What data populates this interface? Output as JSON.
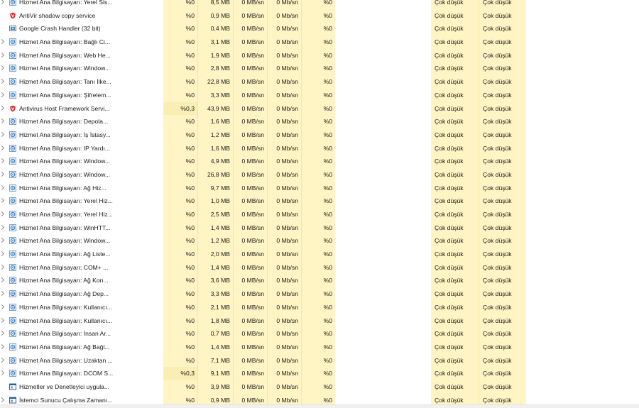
{
  "processes": [
    {
      "name": "Hizmet Ana Bilgisayarı: Yerel Sis...",
      "icon": "gear",
      "expand": true,
      "cpu": "%0",
      "mem": "8,5 MB",
      "disk": "0 MB/sn",
      "net": "0 Mb/sn",
      "gpu": "%0",
      "pwr": "Çok düşük",
      "pwt": "Çok düşük"
    },
    {
      "name": "AntiVir shadow copy service",
      "icon": "shield",
      "expand": false,
      "cpu": "%0",
      "mem": "0,9 MB",
      "disk": "0 MB/sn",
      "net": "0 Mb/sn",
      "gpu": "%0",
      "pwr": "Çok düşük",
      "pwt": "Çok düşük"
    },
    {
      "name": "Google Crash Handler (32 bit)",
      "icon": "app",
      "expand": false,
      "cpu": "%0",
      "mem": "0,4 MB",
      "disk": "0 MB/sn",
      "net": "0 Mb/sn",
      "gpu": "%0",
      "pwr": "Çok düşük",
      "pwt": "Çok düşük"
    },
    {
      "name": "Hizmet Ana Bilgisayarı: Bağlı Ci...",
      "icon": "gear",
      "expand": true,
      "cpu": "%0",
      "mem": "3,1 MB",
      "disk": "0 MB/sn",
      "net": "0 Mb/sn",
      "gpu": "%0",
      "pwr": "Çok düşük",
      "pwt": "Çok düşük"
    },
    {
      "name": "Hizmet Ana Bilgisayarı: Web He...",
      "icon": "gear",
      "expand": true,
      "cpu": "%0",
      "mem": "1,9 MB",
      "disk": "0 MB/sn",
      "net": "0 Mb/sn",
      "gpu": "%0",
      "pwr": "Çok düşük",
      "pwt": "Çok düşük"
    },
    {
      "name": "Hizmet Ana Bilgisayarı: Window...",
      "icon": "gear",
      "expand": true,
      "cpu": "%0",
      "mem": "2,8 MB",
      "disk": "0 MB/sn",
      "net": "0 Mb/sn",
      "gpu": "%0",
      "pwr": "Çok düşük",
      "pwt": "Çok düşük"
    },
    {
      "name": "Hizmet Ana Bilgisayarı: Tanı İlke...",
      "icon": "gear",
      "expand": true,
      "cpu": "%0",
      "mem": "22,8 MB",
      "disk": "0 MB/sn",
      "net": "0 Mb/sn",
      "gpu": "%0",
      "pwr": "Çok düşük",
      "pwt": "Çok düşük"
    },
    {
      "name": "Hizmet Ana Bilgisayarı: Şifrelem...",
      "icon": "gear",
      "expand": true,
      "cpu": "%0",
      "mem": "3,3 MB",
      "disk": "0 MB/sn",
      "net": "0 Mb/sn",
      "gpu": "%0",
      "pwr": "Çok düşük",
      "pwt": "Çok düşük"
    },
    {
      "name": "Antivirus Host Framework Servi...",
      "icon": "shield",
      "expand": true,
      "cpu": "%0,3",
      "mem": "43,9 MB",
      "disk": "0 MB/sn",
      "net": "0 Mb/sn",
      "gpu": "%0",
      "pwr": "Çok düşük",
      "pwt": "Çok düşük",
      "hl": true
    },
    {
      "name": "Hizmet Ana Bilgisayarı: Depola...",
      "icon": "gear",
      "expand": true,
      "cpu": "%0",
      "mem": "1,6 MB",
      "disk": "0 MB/sn",
      "net": "0 Mb/sn",
      "gpu": "%0",
      "pwr": "Çok düşük",
      "pwt": "Çok düşük"
    },
    {
      "name": "Hizmet Ana Bilgisayarı: İş İstasy...",
      "icon": "gear",
      "expand": true,
      "cpu": "%0",
      "mem": "1,2 MB",
      "disk": "0 MB/sn",
      "net": "0 Mb/sn",
      "gpu": "%0",
      "pwr": "Çok düşük",
      "pwt": "Çok düşük"
    },
    {
      "name": "Hizmet Ana Bilgisayarı: IP Yardı...",
      "icon": "gear",
      "expand": true,
      "cpu": "%0",
      "mem": "1,6 MB",
      "disk": "0 MB/sn",
      "net": "0 Mb/sn",
      "gpu": "%0",
      "pwr": "Çok düşük",
      "pwt": "Çok düşük"
    },
    {
      "name": "Hizmet Ana Bilgisayarı: Window...",
      "icon": "gear",
      "expand": true,
      "cpu": "%0",
      "mem": "4,9 MB",
      "disk": "0 MB/sn",
      "net": "0 Mb/sn",
      "gpu": "%0",
      "pwr": "Çok düşük",
      "pwt": "Çok düşük"
    },
    {
      "name": "Hizmet Ana Bilgisayarı: Window...",
      "icon": "gear",
      "expand": true,
      "cpu": "%0",
      "mem": "26,8 MB",
      "disk": "0 MB/sn",
      "net": "0 Mb/sn",
      "gpu": "%0",
      "pwr": "Çok düşük",
      "pwt": "Çok düşük"
    },
    {
      "name": "Hizmet Ana Bilgisayarı: Ağ Hiz...",
      "icon": "gear",
      "expand": true,
      "cpu": "%0",
      "mem": "9,7 MB",
      "disk": "0 MB/sn",
      "net": "0 Mb/sn",
      "gpu": "%0",
      "pwr": "Çok düşük",
      "pwt": "Çok düşük"
    },
    {
      "name": "Hizmet Ana Bilgisayarı: Yerel Hiz...",
      "icon": "gear",
      "expand": true,
      "cpu": "%0",
      "mem": "1,0 MB",
      "disk": "0 MB/sn",
      "net": "0 Mb/sn",
      "gpu": "%0",
      "pwr": "Çok düşük",
      "pwt": "Çok düşük"
    },
    {
      "name": "Hizmet Ana Bilgisayarı: Yerel Hiz...",
      "icon": "gear",
      "expand": true,
      "cpu": "%0",
      "mem": "2,5 MB",
      "disk": "0 MB/sn",
      "net": "0 Mb/sn",
      "gpu": "%0",
      "pwr": "Çok düşük",
      "pwt": "Çok düşük"
    },
    {
      "name": "Hizmet Ana Bilgisayarı: WinHTT...",
      "icon": "gear",
      "expand": true,
      "cpu": "%0",
      "mem": "1,4 MB",
      "disk": "0 MB/sn",
      "net": "0 Mb/sn",
      "gpu": "%0",
      "pwr": "Çok düşük",
      "pwt": "Çok düşük"
    },
    {
      "name": "Hizmet Ana Bilgisayarı: Window...",
      "icon": "gear",
      "expand": true,
      "cpu": "%0",
      "mem": "1,2 MB",
      "disk": "0 MB/sn",
      "net": "0 Mb/sn",
      "gpu": "%0",
      "pwr": "Çok düşük",
      "pwt": "Çok düşük"
    },
    {
      "name": "Hizmet Ana Bilgisayarı: Ağ Liste...",
      "icon": "gear",
      "expand": true,
      "cpu": "%0",
      "mem": "2,0 MB",
      "disk": "0 MB/sn",
      "net": "0 Mb/sn",
      "gpu": "%0",
      "pwr": "Çok düşük",
      "pwt": "Çok düşük"
    },
    {
      "name": "Hizmet Ana Bilgisayarı: COM+ ...",
      "icon": "gear",
      "expand": true,
      "cpu": "%0",
      "mem": "1,4 MB",
      "disk": "0 MB/sn",
      "net": "0 Mb/sn",
      "gpu": "%0",
      "pwr": "Çok düşük",
      "pwt": "Çok düşük"
    },
    {
      "name": "Hizmet Ana Bilgisayarı: Ağ Kon...",
      "icon": "gear",
      "expand": true,
      "cpu": "%0",
      "mem": "3,6 MB",
      "disk": "0 MB/sn",
      "net": "0 Mb/sn",
      "gpu": "%0",
      "pwr": "Çok düşük",
      "pwt": "Çok düşük"
    },
    {
      "name": "Hizmet Ana Bilgisayarı: Ağ Dep...",
      "icon": "gear",
      "expand": true,
      "cpu": "%0",
      "mem": "3,3 MB",
      "disk": "0 MB/sn",
      "net": "0 Mb/sn",
      "gpu": "%0",
      "pwr": "Çok düşük",
      "pwt": "Çok düşük"
    },
    {
      "name": "Hizmet Ana Bilgisayarı: Kullanıcı...",
      "icon": "gear",
      "expand": true,
      "cpu": "%0",
      "mem": "2,1 MB",
      "disk": "0 MB/sn",
      "net": "0 Mb/sn",
      "gpu": "%0",
      "pwr": "Çok düşük",
      "pwt": "Çok düşük"
    },
    {
      "name": "Hizmet Ana Bilgisayarı: Kullanıcı...",
      "icon": "gear",
      "expand": true,
      "cpu": "%0",
      "mem": "1,8 MB",
      "disk": "0 MB/sn",
      "net": "0 Mb/sn",
      "gpu": "%0",
      "pwr": "Çok düşük",
      "pwt": "Çok düşük"
    },
    {
      "name": "Hizmet Ana Bilgisayarı: İnsan Ar...",
      "icon": "gear",
      "expand": true,
      "cpu": "%0",
      "mem": "0,7 MB",
      "disk": "0 MB/sn",
      "net": "0 Mb/sn",
      "gpu": "%0",
      "pwr": "Çok düşük",
      "pwt": "Çok düşük"
    },
    {
      "name": "Hizmet Ana Bilgisayarı: Ağ Bağl...",
      "icon": "gear",
      "expand": true,
      "cpu": "%0",
      "mem": "1,4 MB",
      "disk": "0 MB/sn",
      "net": "0 Mb/sn",
      "gpu": "%0",
      "pwr": "Çok düşük",
      "pwt": "Çok düşük"
    },
    {
      "name": "Hizmet Ana Bilgisayarı: Uzaktan ...",
      "icon": "gear",
      "expand": true,
      "cpu": "%0",
      "mem": "7,1 MB",
      "disk": "0 MB/sn",
      "net": "0 Mb/sn",
      "gpu": "%0",
      "pwr": "Çok düşük",
      "pwt": "Çok düşük"
    },
    {
      "name": "Hizmet Ana Bilgisayarı: DCOM S...",
      "icon": "gear",
      "expand": true,
      "cpu": "%0,3",
      "mem": "9,1 MB",
      "disk": "0 MB/sn",
      "net": "0 Mb/sn",
      "gpu": "%0",
      "pwr": "Çok düşük",
      "pwt": "Çok düşük",
      "hl": true
    },
    {
      "name": "Hizmetler ve Denetleyici uygula...",
      "icon": "window",
      "expand": false,
      "cpu": "%0",
      "mem": "3,9 MB",
      "disk": "0 MB/sn",
      "net": "0 Mb/sn",
      "gpu": "%0",
      "pwr": "Çok düşük",
      "pwt": "Çok düşük"
    },
    {
      "name": "İstemci Sunucu Çalışma Zamanı...",
      "icon": "window",
      "expand": true,
      "cpu": "%0",
      "mem": "0,9 MB",
      "disk": "0 MB/sn",
      "net": "0 Mb/sn",
      "gpu": "%0",
      "pwr": "Çok düşük",
      "pwt": "Çok düşük"
    }
  ],
  "colors": {
    "cell_bg": "#fff4c4",
    "cell_highlight": "#f9eeb4",
    "shield_red": "#d7262a",
    "gear_blue": "#3b7fc4"
  }
}
